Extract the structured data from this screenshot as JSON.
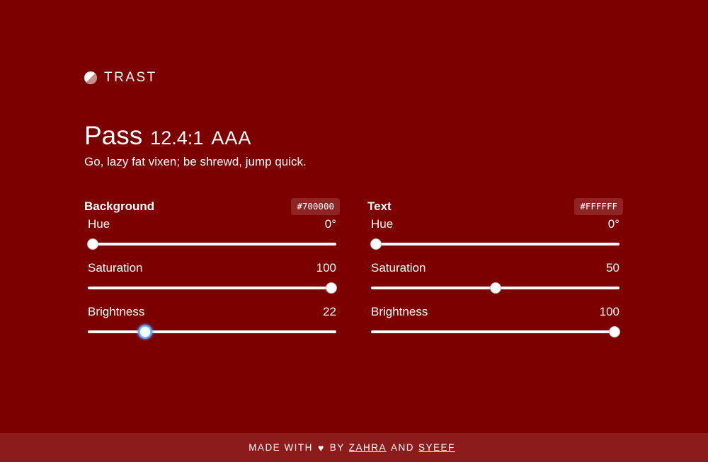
{
  "brand": {
    "name": "TRAST",
    "icon": "contrast-circle-icon"
  },
  "result": {
    "verdict": "Pass",
    "ratio": "12.4:1",
    "level": "AAA",
    "sample_text": "Go, lazy fat vixen; be shrewd, jump quick."
  },
  "background": {
    "title": "Background",
    "hex": "#700000",
    "hue": {
      "label": "Hue",
      "value": "0°",
      "fraction": 0.0
    },
    "saturation": {
      "label": "Saturation",
      "value": "100",
      "fraction": 1.0
    },
    "brightness": {
      "label": "Brightness",
      "value": "22",
      "fraction": 0.22
    }
  },
  "text": {
    "title": "Text",
    "hex": "#FFFFFF",
    "hue": {
      "label": "Hue",
      "value": "0°",
      "fraction": 0.0
    },
    "saturation": {
      "label": "Saturation",
      "value": "50",
      "fraction": 0.5
    },
    "brightness": {
      "label": "Brightness",
      "value": "100",
      "fraction": 1.0
    }
  },
  "footer": {
    "made_with": "MADE WITH",
    "heart": "♥",
    "by": "BY",
    "author1": "ZAHRA",
    "and": "AND",
    "author2": "SYEEF"
  },
  "colors": {
    "page_bg": "#7d0000",
    "footer_bg": "#8c1b1b",
    "text": "#ffffff",
    "focus_ring": "#5aa6ff"
  }
}
